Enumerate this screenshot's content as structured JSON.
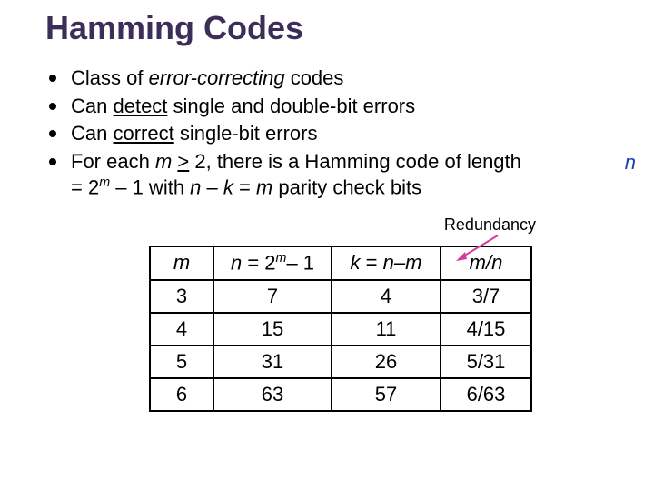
{
  "title": "Hamming Codes",
  "bullets": {
    "b0_pre": "Class of ",
    "b0_em": "error-correcting",
    "b0_post": " codes",
    "b1_pre": "Can ",
    "b1_u": "detect",
    "b1_post": " single and double-bit errors",
    "b2_pre": "Can ",
    "b2_u": "correct",
    "b2_post": " single-bit errors",
    "b3_a": "For each ",
    "b3_m": "m",
    "b3_b": " ",
    "b3_ge": ">",
    "b3_c": " 2, there is a Hamming code of length   ",
    "b3_eq": "= 2",
    "b3_sup": "m",
    "b3_d": " – 1 with ",
    "b3_n": "n",
    "b3_e": " – ",
    "b3_k": "k",
    "b3_f": " = ",
    "b3_m2": "m",
    "b3_g": " parity check bits",
    "b3_side": "n"
  },
  "redundancy_label": "Redundancy",
  "chart_data": {
    "type": "table",
    "headers": {
      "h0": "m",
      "h1_pre": "n",
      "h1_mid": " = 2",
      "h1_sup": "m",
      "h1_post": "– 1",
      "h2_pre": "k",
      "h2_mid": " = ",
      "h2_n": "n",
      "h2_dash": "–",
      "h2_m": "m",
      "h3": "m/n"
    },
    "rows": [
      {
        "m": "3",
        "n": "7",
        "k": "4",
        "mn": "3/7"
      },
      {
        "m": "4",
        "n": "15",
        "k": "11",
        "mn": "4/15"
      },
      {
        "m": "5",
        "n": "31",
        "k": "26",
        "mn": "5/31"
      },
      {
        "m": "6",
        "n": "63",
        "k": "57",
        "mn": "6/63"
      }
    ]
  }
}
